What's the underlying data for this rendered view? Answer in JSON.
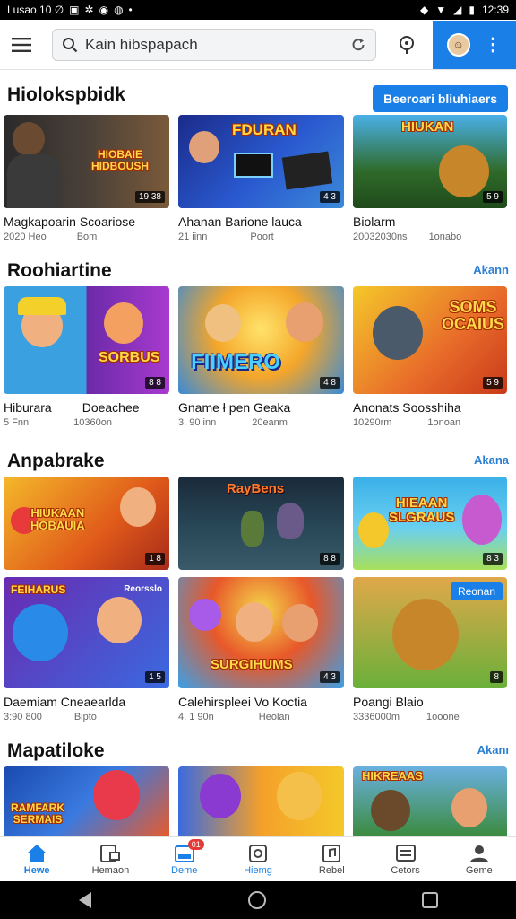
{
  "status_bar": {
    "left_text": "Lusao 10 ∅",
    "time": "12:39"
  },
  "search": {
    "query": "Kain hibspapach"
  },
  "sections": [
    {
      "title": "Hiolokspbidk",
      "action_label": "Beeroari bliuhiaers",
      "cards": [
        {
          "title": "Magkapoarin Scoariose",
          "meta_left": "2020 Heo",
          "meta_right": "Bom",
          "badge": "19 38",
          "label": "HIOBAIE\nHIDBOUSH",
          "colors": [
            "#2b2a2a",
            "#7a5a3a"
          ]
        },
        {
          "title": "Ahanan Barione lauca",
          "meta_left": "21 iinn",
          "meta_right": "Poort",
          "badge": "4 3",
          "label": "FDURAN",
          "colors": [
            "#1b2b8a",
            "#3b8ad8"
          ]
        },
        {
          "title": "Biolarm",
          "meta_left": "20032030ns",
          "meta_right": "1onabo",
          "badge": "5 9",
          "label": "HIUKAN",
          "colors": [
            "#2f6b2a",
            "#e0a24a"
          ]
        }
      ]
    },
    {
      "title": "Roohiartine",
      "action_label": "Akann",
      "cards": [
        {
          "title": "Hiburara",
          "title2": "Doeachee",
          "meta_left": "5 Fnn",
          "meta_right": "10360on",
          "badge": "8 8",
          "label": "SORBUS",
          "colors": [
            "#3aa0e0",
            "#6b2aa8"
          ]
        },
        {
          "title": "Gname  ł  pen Geaka",
          "meta_left": "3. 90 inn",
          "meta_right": "20eanm",
          "badge": "4 8",
          "label": "FIIMERO",
          "colors": [
            "#f4a62a",
            "#3a8ad8"
          ]
        },
        {
          "title": "Anonats Soosshiha",
          "meta_left": "10290rm",
          "meta_right": "1onoan",
          "badge": "5 9",
          "label": "SOMS OCAIUS",
          "colors": [
            "#e86a2a",
            "#f4c82a"
          ]
        }
      ]
    },
    {
      "title": "Anpabrake",
      "action_label": "Akana",
      "cards": [
        {
          "title": "",
          "meta_left": "",
          "meta_right": "",
          "badge": "1 8",
          "label": "HIUKAAN\nHOBAUIA",
          "colors": [
            "#e05a1a",
            "#f4b82a"
          ]
        },
        {
          "title": "",
          "meta_left": "",
          "meta_right": "",
          "badge": "8 8",
          "label": "RayBens",
          "colors": [
            "#1a2a3a",
            "#3a5a6a"
          ]
        },
        {
          "title": "",
          "meta_left": "",
          "meta_right": "",
          "badge": "8 3",
          "label": "HIEAAN\nSLGRAUS",
          "colors": [
            "#3ab0e8",
            "#a8e05a"
          ]
        }
      ]
    },
    {
      "title": "",
      "action_label": "",
      "cards": [
        {
          "title": "Daemiam Cneaearlda",
          "meta_left": "3:90 800",
          "meta_right": "Bipto",
          "badge": "1 5",
          "label": "FEIHARUS",
          "colors": [
            "#6a2ab0",
            "#3a6ae0"
          ],
          "corner": "Reorsslo"
        },
        {
          "title": "Calehirspleei Vo Koctia",
          "meta_left": "4. 1 90n",
          "meta_right": "Heolan",
          "badge": "4 3",
          "label": "SURGIHUMS",
          "colors": [
            "#3aa0e8",
            "#e8582a"
          ]
        },
        {
          "title": "Poangi Blaio",
          "meta_left": "3336000m",
          "meta_right": "1ooone",
          "badge": "8",
          "label": "",
          "colors": [
            "#6ab03a",
            "#e0a84a"
          ],
          "pill": "Reonan"
        }
      ]
    },
    {
      "title": "Mapatiloke",
      "action_label": "Akanı",
      "cards": [
        {
          "title": "",
          "meta_left": "",
          "meta_right": "",
          "badge": "",
          "label": "RAMFARK\nSERMAIS",
          "colors": [
            "#1a4ab0",
            "#e85a2a"
          ]
        },
        {
          "title": "",
          "meta_left": "",
          "meta_right": "",
          "badge": "",
          "label": "",
          "colors": [
            "#f4a02a",
            "#3a6ae0"
          ]
        },
        {
          "title": "",
          "meta_left": "",
          "meta_right": "",
          "badge": "",
          "label": "HIKREAAS",
          "colors": [
            "#6ab0e0",
            "#3a8a3a"
          ]
        }
      ]
    }
  ],
  "bottom_nav": [
    {
      "label": "Hewe",
      "icon": "home-icon",
      "active": true
    },
    {
      "label": "Hemaon",
      "icon": "video-icon",
      "active": false
    },
    {
      "label": "Deme",
      "icon": "library-icon",
      "active": false,
      "badge": "01"
    },
    {
      "label": "Hiemg",
      "icon": "game-icon",
      "active": false
    },
    {
      "label": "Rebel",
      "icon": "music-icon",
      "active": false
    },
    {
      "label": "Cetors",
      "icon": "news-icon",
      "active": false
    },
    {
      "label": "Geme",
      "icon": "profile-icon",
      "active": false
    }
  ],
  "colors": {
    "accent": "#1a7fe6",
    "status_bar": "#000000",
    "badge_red": "#e53935"
  }
}
